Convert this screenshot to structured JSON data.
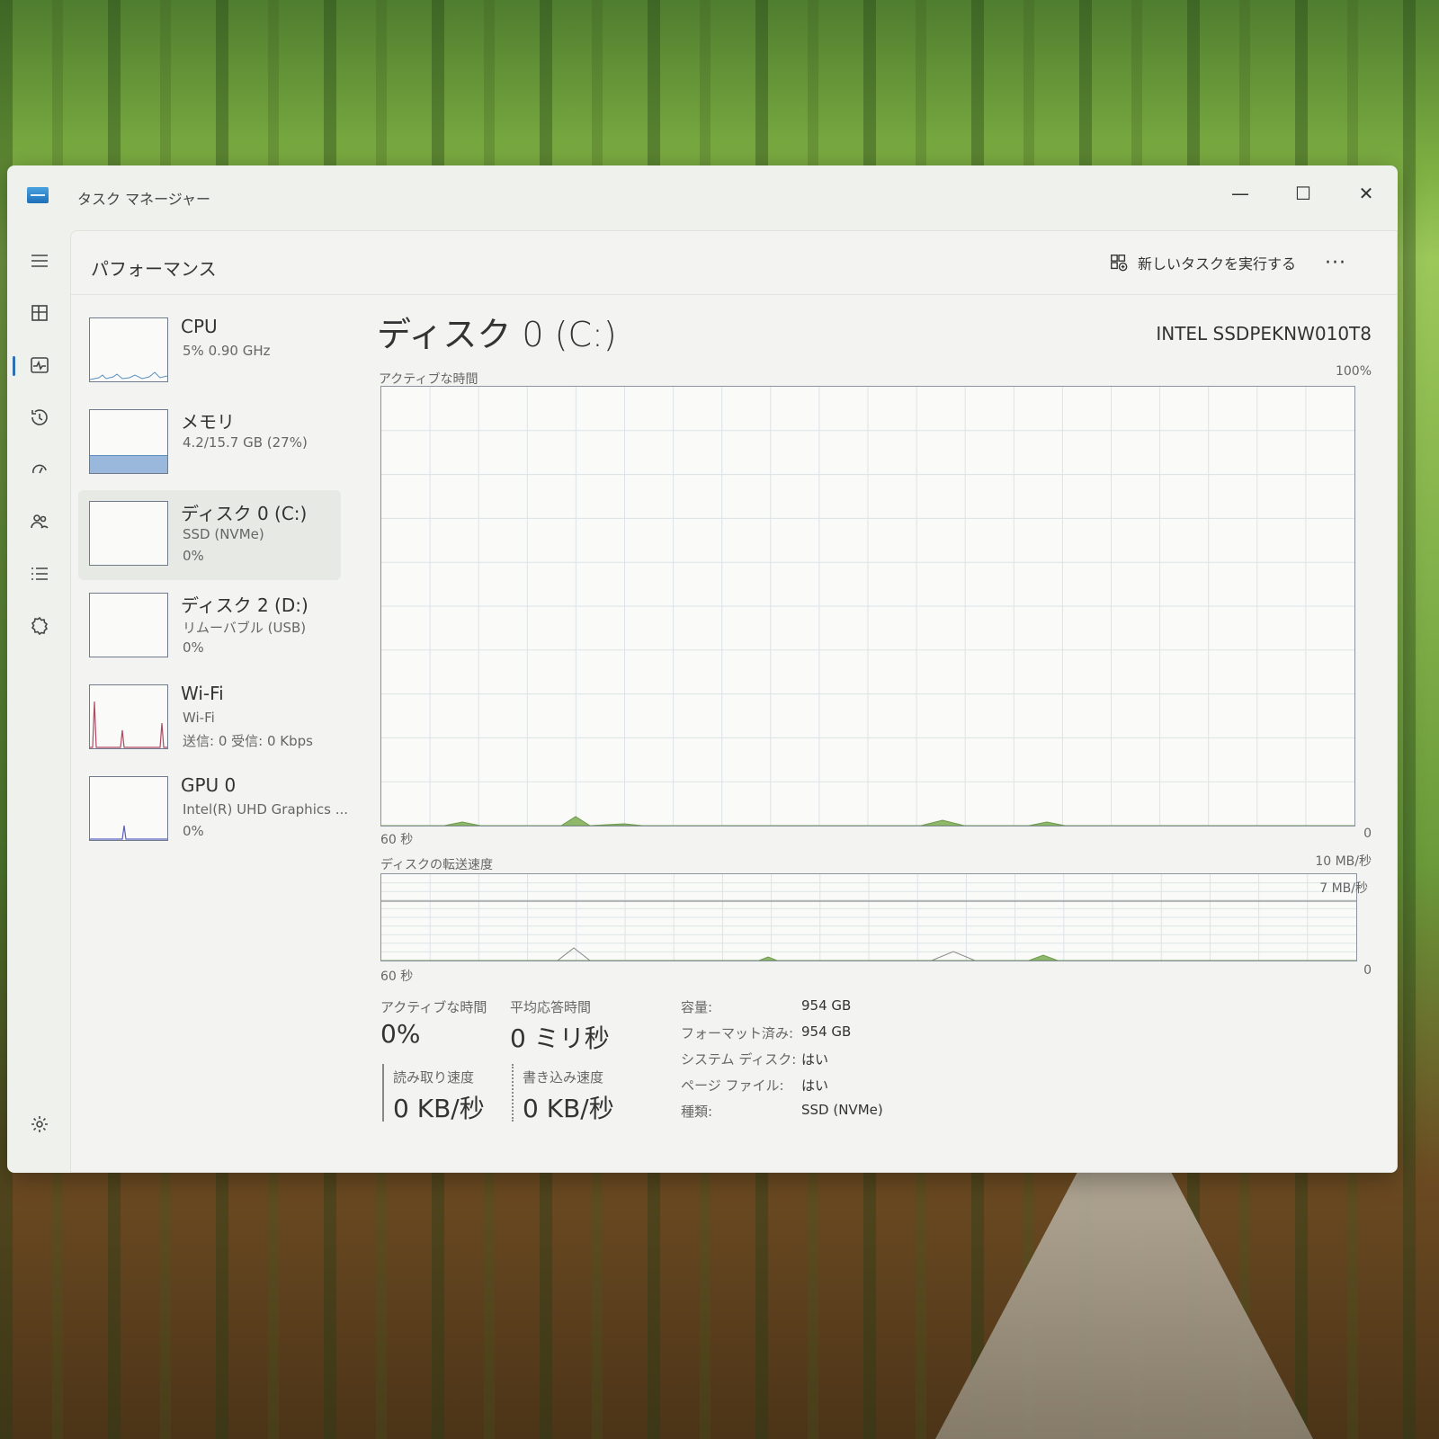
{
  "window": {
    "title": "タスク マネージャー",
    "controls": {
      "minimize": "—",
      "maximize": "☐",
      "close": "✕"
    }
  },
  "nav": {
    "items": [
      "hamburger-icon",
      "processes-icon",
      "performance-icon",
      "history-icon",
      "startup-icon",
      "users-icon",
      "details-icon",
      "services-icon",
      "settings-icon"
    ],
    "active": "performance-icon"
  },
  "header": {
    "page_title": "パフォーマンス",
    "run_task_label": "新しいタスクを実行する",
    "more": "···"
  },
  "devices": [
    {
      "name": "CPU",
      "sub1": "5%  0.90 GHz",
      "sub2": ""
    },
    {
      "name": "メモリ",
      "sub1": "4.2/15.7 GB (27%)",
      "sub2": ""
    },
    {
      "name": "ディスク 0 (C:)",
      "sub1": "SSD (NVMe)",
      "sub2": "0%",
      "selected": true
    },
    {
      "name": "ディスク 2 (D:)",
      "sub1": "リムーバブル (USB)",
      "sub2": "0%"
    },
    {
      "name": "Wi-Fi",
      "sub1": "Wi-Fi",
      "sub2": "送信: 0  受信: 0 Kbps"
    },
    {
      "name": "GPU 0",
      "sub1": "Intel(R) UHD Graphics ...",
      "sub2": "0%"
    }
  ],
  "detail": {
    "title": "ディスク 0 (C:)",
    "model": "INTEL SSDPEKNW010T8",
    "active_chart": {
      "label": "アクティブな時間",
      "max": "100%",
      "left": "60 秒",
      "right": "0"
    },
    "transfer_chart": {
      "label": "ディスクの転送速度",
      "max": "10 MB/秒",
      "line_label": "7 MB/秒",
      "left": "60 秒",
      "right": "0"
    },
    "stats": {
      "active_time_label": "アクティブな時間",
      "active_time_value": "0%",
      "avg_response_label": "平均応答時間",
      "avg_response_value": "0 ミリ秒",
      "read_label": "読み取り速度",
      "read_value": "0 KB/秒",
      "write_label": "書き込み速度",
      "write_value": "0 KB/秒"
    },
    "props": [
      {
        "k": "容量:",
        "v": "954 GB"
      },
      {
        "k": "フォーマット済み:",
        "v": "954 GB"
      },
      {
        "k": "システム ディスク:",
        "v": "はい"
      },
      {
        "k": "ページ ファイル:",
        "v": "はい"
      },
      {
        "k": "種類:",
        "v": "SSD (NVMe)"
      }
    ]
  },
  "colors": {
    "accent": "#2f6fb3",
    "disk_fill": "#8fb86a",
    "memory_fill": "#9ab7dc",
    "wifi_line": "#b04a63",
    "gpu_line": "#5a5fc0"
  }
}
